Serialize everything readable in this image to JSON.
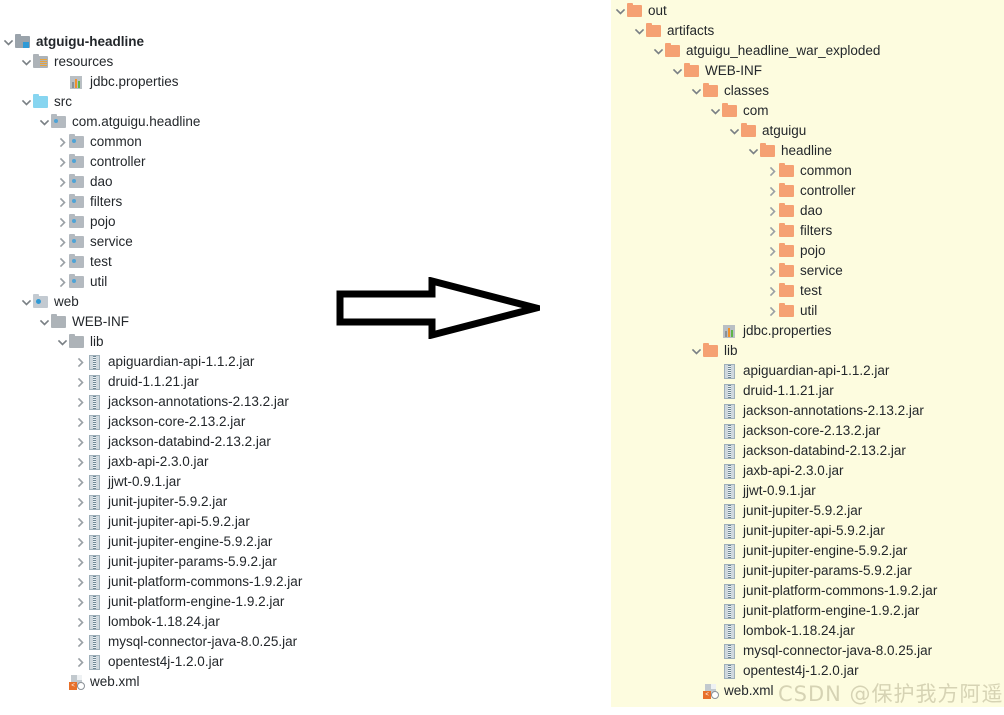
{
  "left_tree": {
    "name": "project-source-tree",
    "rows": [
      {
        "label": "atguigu-headline",
        "depth": 0,
        "toggle": "expanded",
        "icon": "module-root-icon",
        "bold": true
      },
      {
        "label": "resources",
        "depth": 1,
        "toggle": "expanded",
        "icon": "resources-folder-icon",
        "bold": false
      },
      {
        "label": "jdbc.properties",
        "depth": 3,
        "toggle": "none",
        "icon": "properties-file-icon",
        "bold": false
      },
      {
        "label": "src",
        "depth": 1,
        "toggle": "expanded",
        "icon": "sources-folder-icon",
        "bold": false
      },
      {
        "label": "com.atguigu.headline",
        "depth": 2,
        "toggle": "expanded",
        "icon": "package-icon",
        "bold": false
      },
      {
        "label": "common",
        "depth": 3,
        "toggle": "collapsed",
        "icon": "package-icon",
        "bold": false
      },
      {
        "label": "controller",
        "depth": 3,
        "toggle": "collapsed",
        "icon": "package-icon",
        "bold": false
      },
      {
        "label": "dao",
        "depth": 3,
        "toggle": "collapsed",
        "icon": "package-icon",
        "bold": false
      },
      {
        "label": "filters",
        "depth": 3,
        "toggle": "collapsed",
        "icon": "package-icon",
        "bold": false
      },
      {
        "label": "pojo",
        "depth": 3,
        "toggle": "collapsed",
        "icon": "package-icon",
        "bold": false
      },
      {
        "label": "service",
        "depth": 3,
        "toggle": "collapsed",
        "icon": "package-icon",
        "bold": false
      },
      {
        "label": "test",
        "depth": 3,
        "toggle": "collapsed",
        "icon": "package-icon",
        "bold": false
      },
      {
        "label": "util",
        "depth": 3,
        "toggle": "collapsed",
        "icon": "package-icon",
        "bold": false
      },
      {
        "label": "web",
        "depth": 1,
        "toggle": "expanded",
        "icon": "web-folder-icon",
        "bold": false
      },
      {
        "label": "WEB-INF",
        "depth": 2,
        "toggle": "expanded",
        "icon": "folder-gray-icon",
        "bold": false
      },
      {
        "label": "lib",
        "depth": 3,
        "toggle": "expanded",
        "icon": "folder-gray-icon",
        "bold": false
      },
      {
        "label": "apiguardian-api-1.1.2.jar",
        "depth": 4,
        "toggle": "collapsed",
        "icon": "jar-file-icon",
        "bold": false
      },
      {
        "label": "druid-1.1.21.jar",
        "depth": 4,
        "toggle": "collapsed",
        "icon": "jar-file-icon",
        "bold": false
      },
      {
        "label": "jackson-annotations-2.13.2.jar",
        "depth": 4,
        "toggle": "collapsed",
        "icon": "jar-file-icon",
        "bold": false
      },
      {
        "label": "jackson-core-2.13.2.jar",
        "depth": 4,
        "toggle": "collapsed",
        "icon": "jar-file-icon",
        "bold": false
      },
      {
        "label": "jackson-databind-2.13.2.jar",
        "depth": 4,
        "toggle": "collapsed",
        "icon": "jar-file-icon",
        "bold": false
      },
      {
        "label": "jaxb-api-2.3.0.jar",
        "depth": 4,
        "toggle": "collapsed",
        "icon": "jar-file-icon",
        "bold": false
      },
      {
        "label": "jjwt-0.9.1.jar",
        "depth": 4,
        "toggle": "collapsed",
        "icon": "jar-file-icon",
        "bold": false
      },
      {
        "label": "junit-jupiter-5.9.2.jar",
        "depth": 4,
        "toggle": "collapsed",
        "icon": "jar-file-icon",
        "bold": false
      },
      {
        "label": "junit-jupiter-api-5.9.2.jar",
        "depth": 4,
        "toggle": "collapsed",
        "icon": "jar-file-icon",
        "bold": false
      },
      {
        "label": "junit-jupiter-engine-5.9.2.jar",
        "depth": 4,
        "toggle": "collapsed",
        "icon": "jar-file-icon",
        "bold": false
      },
      {
        "label": "junit-jupiter-params-5.9.2.jar",
        "depth": 4,
        "toggle": "collapsed",
        "icon": "jar-file-icon",
        "bold": false
      },
      {
        "label": "junit-platform-commons-1.9.2.jar",
        "depth": 4,
        "toggle": "collapsed",
        "icon": "jar-file-icon",
        "bold": false
      },
      {
        "label": "junit-platform-engine-1.9.2.jar",
        "depth": 4,
        "toggle": "collapsed",
        "icon": "jar-file-icon",
        "bold": false
      },
      {
        "label": "lombok-1.18.24.jar",
        "depth": 4,
        "toggle": "collapsed",
        "icon": "jar-file-icon",
        "bold": false
      },
      {
        "label": "mysql-connector-java-8.0.25.jar",
        "depth": 4,
        "toggle": "collapsed",
        "icon": "jar-file-icon",
        "bold": false
      },
      {
        "label": "opentest4j-1.2.0.jar",
        "depth": 4,
        "toggle": "collapsed",
        "icon": "jar-file-icon",
        "bold": false
      },
      {
        "label": "web.xml",
        "depth": 3,
        "toggle": "none",
        "icon": "xml-file-icon",
        "bold": false
      }
    ]
  },
  "right_tree": {
    "name": "artifact-output-tree",
    "rows": [
      {
        "label": "out",
        "depth": 0,
        "toggle": "expanded",
        "icon": "folder-orange-icon"
      },
      {
        "label": "artifacts",
        "depth": 1,
        "toggle": "expanded",
        "icon": "folder-orange-icon"
      },
      {
        "label": "atguigu_headline_war_exploded",
        "depth": 2,
        "toggle": "expanded",
        "icon": "folder-orange-icon"
      },
      {
        "label": "WEB-INF",
        "depth": 3,
        "toggle": "expanded",
        "icon": "folder-orange-icon"
      },
      {
        "label": "classes",
        "depth": 4,
        "toggle": "expanded",
        "icon": "folder-orange-icon"
      },
      {
        "label": "com",
        "depth": 5,
        "toggle": "expanded",
        "icon": "folder-orange-icon"
      },
      {
        "label": "atguigu",
        "depth": 6,
        "toggle": "expanded",
        "icon": "folder-orange-icon"
      },
      {
        "label": "headline",
        "depth": 7,
        "toggle": "expanded",
        "icon": "folder-orange-icon"
      },
      {
        "label": "common",
        "depth": 8,
        "toggle": "collapsed",
        "icon": "folder-orange-icon"
      },
      {
        "label": "controller",
        "depth": 8,
        "toggle": "collapsed",
        "icon": "folder-orange-icon"
      },
      {
        "label": "dao",
        "depth": 8,
        "toggle": "collapsed",
        "icon": "folder-orange-icon"
      },
      {
        "label": "filters",
        "depth": 8,
        "toggle": "collapsed",
        "icon": "folder-orange-icon"
      },
      {
        "label": "pojo",
        "depth": 8,
        "toggle": "collapsed",
        "icon": "folder-orange-icon"
      },
      {
        "label": "service",
        "depth": 8,
        "toggle": "collapsed",
        "icon": "folder-orange-icon"
      },
      {
        "label": "test",
        "depth": 8,
        "toggle": "collapsed",
        "icon": "folder-orange-icon"
      },
      {
        "label": "util",
        "depth": 8,
        "toggle": "collapsed",
        "icon": "folder-orange-icon"
      },
      {
        "label": "jdbc.properties",
        "depth": 5,
        "toggle": "none",
        "icon": "properties-file-icon"
      },
      {
        "label": "lib",
        "depth": 4,
        "toggle": "expanded",
        "icon": "folder-orange-icon"
      },
      {
        "label": "apiguardian-api-1.1.2.jar",
        "depth": 5,
        "toggle": "none",
        "icon": "jar-file-icon"
      },
      {
        "label": "druid-1.1.21.jar",
        "depth": 5,
        "toggle": "none",
        "icon": "jar-file-icon"
      },
      {
        "label": "jackson-annotations-2.13.2.jar",
        "depth": 5,
        "toggle": "none",
        "icon": "jar-file-icon"
      },
      {
        "label": "jackson-core-2.13.2.jar",
        "depth": 5,
        "toggle": "none",
        "icon": "jar-file-icon"
      },
      {
        "label": "jackson-databind-2.13.2.jar",
        "depth": 5,
        "toggle": "none",
        "icon": "jar-file-icon"
      },
      {
        "label": "jaxb-api-2.3.0.jar",
        "depth": 5,
        "toggle": "none",
        "icon": "jar-file-icon"
      },
      {
        "label": "jjwt-0.9.1.jar",
        "depth": 5,
        "toggle": "none",
        "icon": "jar-file-icon"
      },
      {
        "label": "junit-jupiter-5.9.2.jar",
        "depth": 5,
        "toggle": "none",
        "icon": "jar-file-icon"
      },
      {
        "label": "junit-jupiter-api-5.9.2.jar",
        "depth": 5,
        "toggle": "none",
        "icon": "jar-file-icon"
      },
      {
        "label": "junit-jupiter-engine-5.9.2.jar",
        "depth": 5,
        "toggle": "none",
        "icon": "jar-file-icon"
      },
      {
        "label": "junit-jupiter-params-5.9.2.jar",
        "depth": 5,
        "toggle": "none",
        "icon": "jar-file-icon"
      },
      {
        "label": "junit-platform-commons-1.9.2.jar",
        "depth": 5,
        "toggle": "none",
        "icon": "jar-file-icon"
      },
      {
        "label": "junit-platform-engine-1.9.2.jar",
        "depth": 5,
        "toggle": "none",
        "icon": "jar-file-icon"
      },
      {
        "label": "lombok-1.18.24.jar",
        "depth": 5,
        "toggle": "none",
        "icon": "jar-file-icon"
      },
      {
        "label": "mysql-connector-java-8.0.25.jar",
        "depth": 5,
        "toggle": "none",
        "icon": "jar-file-icon"
      },
      {
        "label": "opentest4j-1.2.0.jar",
        "depth": 5,
        "toggle": "none",
        "icon": "jar-file-icon"
      },
      {
        "label": "web.xml",
        "depth": 4,
        "toggle": "none",
        "icon": "xml-file-icon"
      }
    ]
  },
  "arrow": {
    "name": "right-arrow-graphic",
    "direction": "right"
  },
  "watermark": {
    "text": "CSDN @保护我方阿遥"
  },
  "colors": {
    "folder_orange": "#f5a173",
    "folder_gray": "#adb3b8",
    "folder_blue": "#87d5f0",
    "panel_yellow": "#fdfcdf",
    "text": "#23272b",
    "watermark": "#d6d3b4"
  }
}
